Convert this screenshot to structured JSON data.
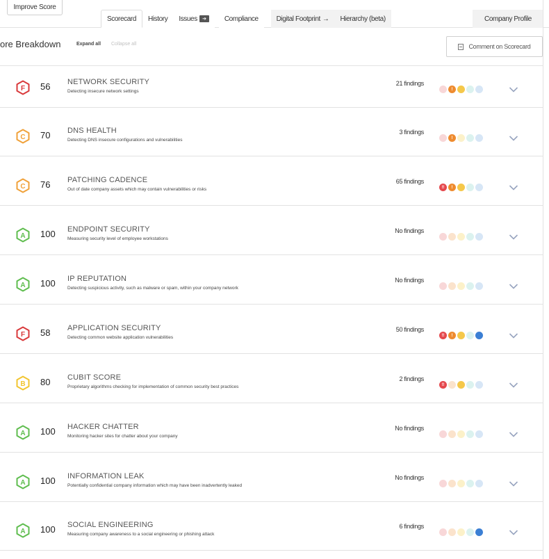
{
  "toolbar": {
    "improve_score_label": "Improve Score"
  },
  "tabs": [
    {
      "label": "Scorecard",
      "active": true,
      "shaded": false
    },
    {
      "label": "History",
      "active": false,
      "shaded": false
    },
    {
      "label": "Issues",
      "active": false,
      "shaded": false,
      "badge_icon": "arrow-box-icon"
    },
    {
      "label": "Compliance",
      "active": false,
      "shaded": false
    },
    {
      "label": "Digital Footprint",
      "active": false,
      "shaded": true,
      "suffix": "→"
    },
    {
      "label": "Hierarchy (beta)",
      "active": false,
      "shaded": true
    }
  ],
  "company_profile_label": "Company Profile",
  "section": {
    "heading": "ore Breakdown",
    "expand_all": "Expand all",
    "collapse_all": "Collapse all",
    "comment_label": "Comment on Scorecard"
  },
  "colors": {
    "grade_F": "#d9393b",
    "grade_C": "#f0a13a",
    "grade_B": "#f2c530",
    "grade_A": "#5fbd4f",
    "sev_critical": "#e5484d",
    "sev_high": "#ee8b2f",
    "sev_medium": "#f5c84a",
    "sev_low": "#7fd1c8",
    "sev_info": "#3b7fd4",
    "sev_critical_muted": "#f8d7d8",
    "sev_high_muted": "#fbe3cc",
    "sev_medium_muted": "#fcf1c9",
    "sev_low_muted": "#dbf2ef",
    "sev_info_muted": "#d7e6f6",
    "chevron": "#98a4bf"
  },
  "categories": [
    {
      "grade": "F",
      "score": "56",
      "title": "NETWORK SECURITY",
      "description": "Detecting insecure network settings",
      "findings": "21 findings",
      "severity": [
        {
          "level": "critical",
          "active": false,
          "label": ""
        },
        {
          "level": "high",
          "active": true,
          "label": "!"
        },
        {
          "level": "medium",
          "active": true,
          "label": ""
        },
        {
          "level": "low",
          "active": false,
          "label": ""
        },
        {
          "level": "info",
          "active": false,
          "label": ""
        }
      ]
    },
    {
      "grade": "C",
      "score": "70",
      "title": "DNS HEALTH",
      "description": "Detecting DNS insecure configurations and vulnerabilities",
      "findings": "3 findings",
      "severity": [
        {
          "level": "critical",
          "active": false,
          "label": ""
        },
        {
          "level": "high",
          "active": true,
          "label": "!"
        },
        {
          "level": "medium",
          "active": false,
          "label": ""
        },
        {
          "level": "low",
          "active": false,
          "label": ""
        },
        {
          "level": "info",
          "active": false,
          "label": ""
        }
      ]
    },
    {
      "grade": "C",
      "score": "76",
      "title": "PATCHING CADENCE",
      "description": "Out of date company assets which may contain vulnerabilities or risks",
      "findings": "65 findings",
      "severity": [
        {
          "level": "critical",
          "active": true,
          "label": "!!"
        },
        {
          "level": "high",
          "active": true,
          "label": "!"
        },
        {
          "level": "medium",
          "active": true,
          "label": ""
        },
        {
          "level": "low",
          "active": false,
          "label": ""
        },
        {
          "level": "info",
          "active": false,
          "label": ""
        }
      ]
    },
    {
      "grade": "A",
      "score": "100",
      "title": "ENDPOINT SECURITY",
      "description": "Measuring security level of employee workstations",
      "findings": "No findings",
      "severity": [
        {
          "level": "critical",
          "active": false,
          "label": ""
        },
        {
          "level": "high",
          "active": false,
          "label": ""
        },
        {
          "level": "medium",
          "active": false,
          "label": ""
        },
        {
          "level": "low",
          "active": false,
          "label": ""
        },
        {
          "level": "info",
          "active": false,
          "label": ""
        }
      ]
    },
    {
      "grade": "A",
      "score": "100",
      "title": "IP REPUTATION",
      "description": "Detecting suspicious activity, such as malware or spam, within your company network",
      "findings": "No findings",
      "severity": [
        {
          "level": "critical",
          "active": false,
          "label": ""
        },
        {
          "level": "high",
          "active": false,
          "label": ""
        },
        {
          "level": "medium",
          "active": false,
          "label": ""
        },
        {
          "level": "low",
          "active": false,
          "label": ""
        },
        {
          "level": "info",
          "active": false,
          "label": ""
        }
      ]
    },
    {
      "grade": "F",
      "score": "58",
      "title": "APPLICATION SECURITY",
      "description": "Detecting common website application vulnerabilities",
      "findings": "50 findings",
      "severity": [
        {
          "level": "critical",
          "active": true,
          "label": "!!"
        },
        {
          "level": "high",
          "active": true,
          "label": "!"
        },
        {
          "level": "medium",
          "active": true,
          "label": ""
        },
        {
          "level": "low",
          "active": false,
          "label": ""
        },
        {
          "level": "info",
          "active": true,
          "label": ""
        }
      ]
    },
    {
      "grade": "B",
      "score": "80",
      "title": "CUBIT SCORE",
      "description": "Proprietary algorithms checking for implementation of common security best practices",
      "findings": "2 findings",
      "severity": [
        {
          "level": "critical",
          "active": true,
          "label": "!!"
        },
        {
          "level": "high",
          "active": false,
          "label": ""
        },
        {
          "level": "medium",
          "active": true,
          "label": ""
        },
        {
          "level": "low",
          "active": false,
          "label": ""
        },
        {
          "level": "info",
          "active": false,
          "label": ""
        }
      ]
    },
    {
      "grade": "A",
      "score": "100",
      "title": "HACKER CHATTER",
      "description": "Monitoring hacker sites for chatter about your company",
      "findings": "No findings",
      "severity": [
        {
          "level": "critical",
          "active": false,
          "label": ""
        },
        {
          "level": "high",
          "active": false,
          "label": ""
        },
        {
          "level": "medium",
          "active": false,
          "label": ""
        },
        {
          "level": "low",
          "active": false,
          "label": ""
        },
        {
          "level": "info",
          "active": false,
          "label": ""
        }
      ]
    },
    {
      "grade": "A",
      "score": "100",
      "title": "INFORMATION LEAK",
      "description": "Potentially confidential company information which may have been inadvertently leaked",
      "findings": "No findings",
      "severity": [
        {
          "level": "critical",
          "active": false,
          "label": ""
        },
        {
          "level": "high",
          "active": false,
          "label": ""
        },
        {
          "level": "medium",
          "active": false,
          "label": ""
        },
        {
          "level": "low",
          "active": false,
          "label": ""
        },
        {
          "level": "info",
          "active": false,
          "label": ""
        }
      ]
    },
    {
      "grade": "A",
      "score": "100",
      "title": "SOCIAL ENGINEERING",
      "description": "Measuring company awareness to a social engineering or phishing attack",
      "findings": "6 findings",
      "severity": [
        {
          "level": "critical",
          "active": false,
          "label": ""
        },
        {
          "level": "high",
          "active": false,
          "label": ""
        },
        {
          "level": "medium",
          "active": false,
          "label": ""
        },
        {
          "level": "low",
          "active": false,
          "label": ""
        },
        {
          "level": "info",
          "active": true,
          "label": ""
        }
      ]
    }
  ]
}
